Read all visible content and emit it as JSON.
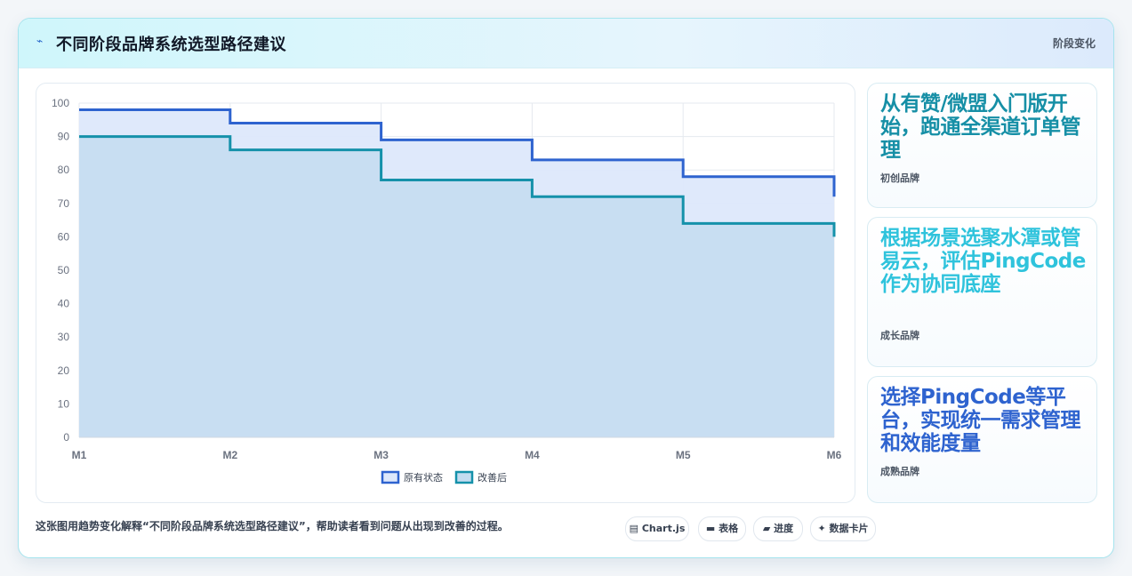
{
  "header": {
    "title": "不同阶段品牌系统选型路径建议",
    "tag": "阶段变化",
    "icon": "spark-icon"
  },
  "colors": {
    "series_original": "#2e63cf",
    "series_improved": "#1591aa",
    "fill_original": "#dde8fb",
    "fill_improved": "#c4dcf0"
  },
  "chart_data": {
    "type": "line",
    "stepped": true,
    "x": [
      "M1",
      "M2",
      "M3",
      "M4",
      "M5",
      "M6"
    ],
    "ylim": [
      0,
      100
    ],
    "yticks": [
      0,
      10,
      20,
      30,
      40,
      50,
      60,
      70,
      80,
      90,
      100
    ],
    "grid": true,
    "legend_position": "bottom",
    "series": [
      {
        "name": "原有状态",
        "values": [
          98,
          94,
          89,
          83,
          78,
          72
        ]
      },
      {
        "name": "改善后",
        "values": [
          90,
          86,
          77,
          72,
          64,
          60
        ]
      }
    ]
  },
  "cards": [
    {
      "title": "从有赞/微盟入门版开始，跑通全渠道订单管理",
      "subtitle": "初创品牌",
      "color": "#168fa6"
    },
    {
      "title": "根据场景选聚水潭或管易云，评估PingCode作为协同底座",
      "subtitle": "成长品牌",
      "color": "#2fc3dc"
    },
    {
      "title": "选择PingCode等平台，实现统一需求管理和效能度量",
      "subtitle": "成熟品牌",
      "color": "#2e63cf"
    }
  ],
  "footer": {
    "description": "这张图用趋势变化解释“不同阶段品牌系统选型路径建议”，帮助读者看到问题从出现到改善的过程。",
    "pills": [
      {
        "icon": "chart-icon",
        "glyph": "▤",
        "label": "Chart.js"
      },
      {
        "icon": "table-icon",
        "glyph": "▬",
        "label": "表格"
      },
      {
        "icon": "progress-icon",
        "glyph": "▰",
        "label": "进度"
      },
      {
        "icon": "sparkle-icon",
        "glyph": "✦",
        "label": "数据卡片"
      }
    ]
  }
}
